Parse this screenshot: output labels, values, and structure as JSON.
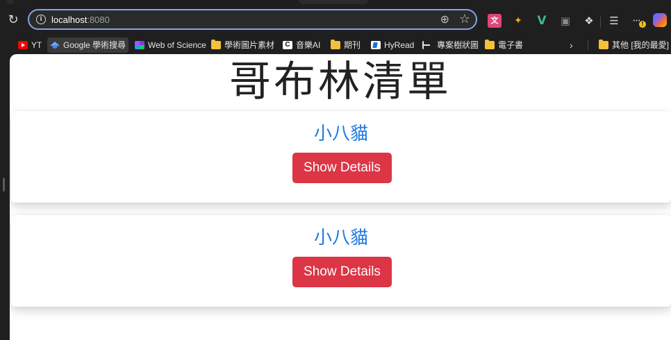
{
  "browser": {
    "url_host": "localhost",
    "url_port": ":8080",
    "extensions": [
      "translate-extension",
      "cookie-extension",
      "vue-devtools",
      "screenshot-extension",
      "extensions-puzzle",
      "favorites",
      "more-options",
      "copilot"
    ],
    "bookmarks": [
      {
        "label": "YT",
        "icon": "youtube-icon"
      },
      {
        "label": "Google 學術搜尋",
        "icon": "google-scholar-icon"
      },
      {
        "label": "Web of Science",
        "icon": "web-of-science-icon"
      },
      {
        "label": "學術圖片素材",
        "icon": "folder-icon"
      },
      {
        "label": "音樂AI",
        "icon": "app-c-icon"
      },
      {
        "label": "期刊",
        "icon": "folder-icon"
      },
      {
        "label": "HyRead",
        "icon": "hyread-icon"
      },
      {
        "label": "專案樹狀圖",
        "icon": "project-tree-icon"
      },
      {
        "label": "電子書",
        "icon": "folder-icon"
      }
    ],
    "other_bookmarks_label": "其他 [我的最愛]",
    "overflow_chevron": "›"
  },
  "page": {
    "title": "哥布林清單",
    "items": [
      {
        "name": "小八貓",
        "button_label": "Show Details"
      },
      {
        "name": "小八貓",
        "button_label": "Show Details"
      }
    ]
  },
  "colors": {
    "accent_link": "#1f7ae0",
    "button_danger": "#dc3545",
    "omnibox_focus": "#7fa7ec"
  }
}
